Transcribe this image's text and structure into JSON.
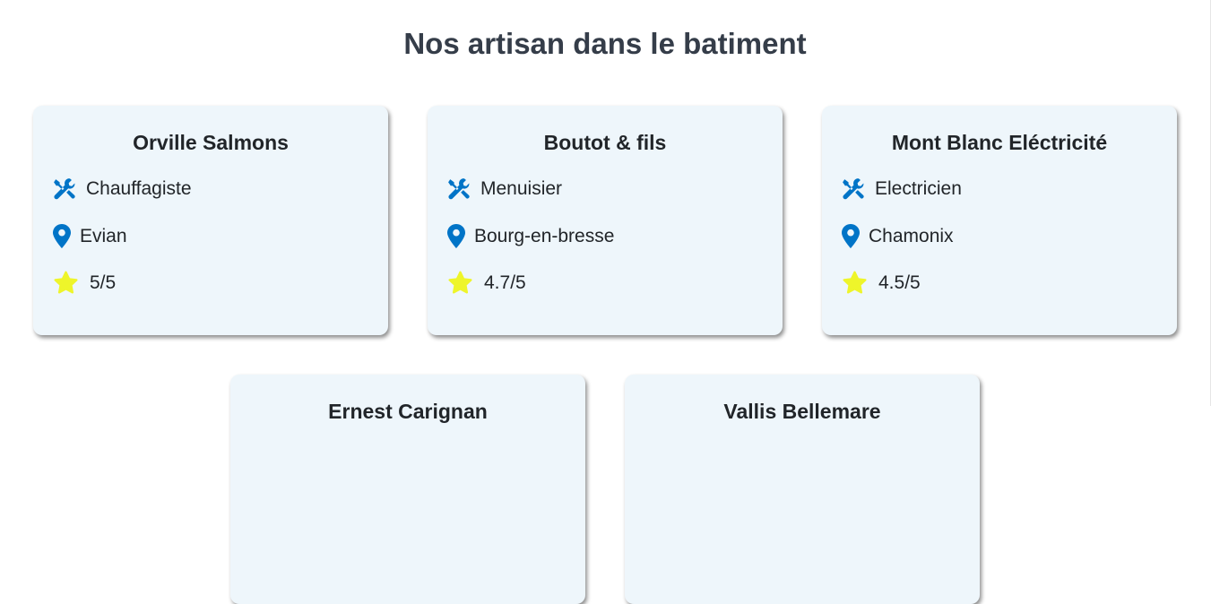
{
  "page_title": "Nos artisan dans le batiment",
  "colors": {
    "icon": "#0074c7",
    "star": "#eef52a",
    "card_bg": "#eef6fb",
    "title": "#353d49"
  },
  "artisans": [
    {
      "name": "Orville Salmons",
      "specialty": "Chauffagiste",
      "city": "Evian",
      "rating": "5/5"
    },
    {
      "name": "Boutot & fils",
      "specialty": "Menuisier",
      "city": "Bourg-en-bresse",
      "rating": "4.7/5"
    },
    {
      "name": "Mont Blanc Eléctricité",
      "specialty": "Electricien",
      "city": "Chamonix",
      "rating": "4.5/5"
    },
    {
      "name": "Ernest Carignan"
    },
    {
      "name": "Vallis Bellemare"
    }
  ]
}
